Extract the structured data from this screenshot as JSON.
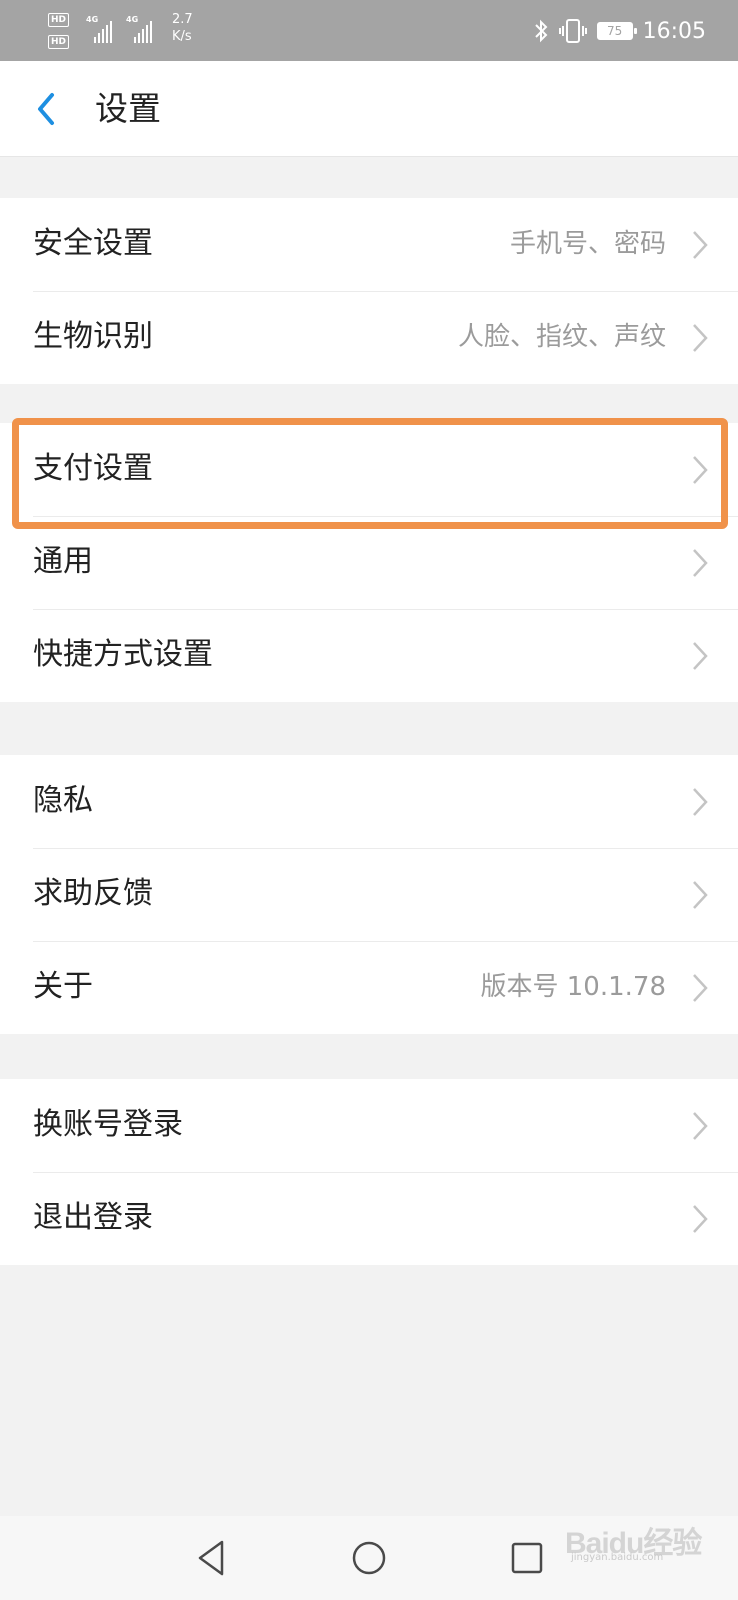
{
  "status_bar": {
    "hd_1": "HD",
    "hd_2": "HD",
    "net_1": "4G",
    "net_2": "4G",
    "speed_value": "2.7",
    "speed_unit": "K/s",
    "battery": "75",
    "time": "16:05"
  },
  "header": {
    "title": "设置"
  },
  "groups": [
    {
      "items": [
        {
          "label": "安全设置",
          "value": "手机号、密码"
        },
        {
          "label": "生物识别",
          "value": "人脸、指纹、声纹"
        }
      ]
    },
    {
      "items": [
        {
          "label": "支付设置",
          "value": ""
        },
        {
          "label": "通用",
          "value": ""
        },
        {
          "label": "快捷方式设置",
          "value": ""
        }
      ]
    },
    {
      "items": [
        {
          "label": "隐私",
          "value": ""
        },
        {
          "label": "求助反馈",
          "value": ""
        },
        {
          "label": "关于",
          "value": "版本号 10.1.78"
        }
      ]
    },
    {
      "items": [
        {
          "label": "换账号登录",
          "value": ""
        },
        {
          "label": "退出登录",
          "value": ""
        }
      ]
    }
  ],
  "highlight_color": "#f0924a",
  "accent_color": "#1e8fe1",
  "icons": {
    "back": "chevron-left-icon",
    "row": "chevron-right-icon",
    "nav_back": "triangle-back-icon",
    "nav_home": "circle-home-icon",
    "nav_recent": "square-recent-icon"
  },
  "watermark": {
    "logo": "Baidu经验",
    "sub": "jingyan.baidu.com"
  }
}
